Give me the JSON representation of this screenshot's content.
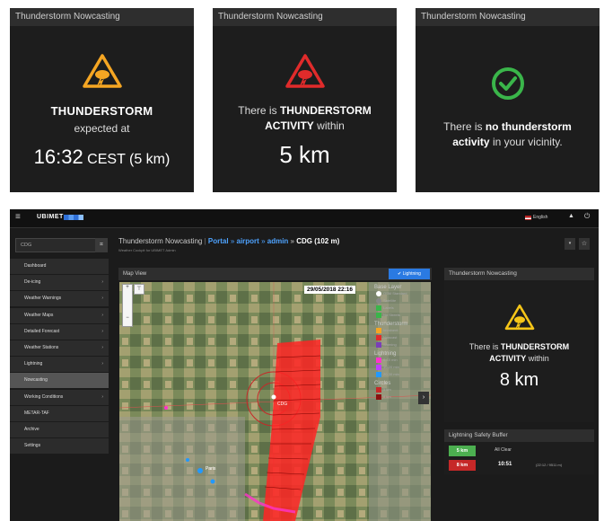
{
  "cards": [
    {
      "header": "Thunderstorm Nowcasting",
      "line1": "THUNDERSTORM",
      "line2": "expected at",
      "time": "16:32",
      "time_suffix": "CEST (5 km)",
      "icon": "orange-warning-icon",
      "color": "#f5a623"
    },
    {
      "header": "Thunderstorm Nowcasting",
      "prefix": "There is",
      "bold1": "THUNDERSTORM",
      "bold2": "ACTIVITY",
      "suffix": "within",
      "distance": "5 km",
      "icon": "red-warning-icon",
      "color": "#e02b2b"
    },
    {
      "header": "Thunderstorm Nowcasting",
      "prefix": "There is",
      "bold1": "no thunderstorm",
      "bold2": "activity",
      "suffix": "in your vicinity.",
      "icon": "green-check-icon",
      "color": "#3ab54a"
    }
  ],
  "app": {
    "brand": "UBIMET",
    "language": "English",
    "search_value": "CDG",
    "title_prefix": "Thunderstorm Nowcasting",
    "crumb1": "Portal",
    "crumb2": "airport",
    "crumb3": "admin",
    "crumb4": "CDG (102 m)",
    "subtitle": "Weather Cockpit for UBIMET Admin",
    "sidebar": [
      {
        "label": "Dashboard",
        "arrow": false,
        "active": false
      },
      {
        "label": "De-icing",
        "arrow": true,
        "active": false
      },
      {
        "label": "Weather Warnings",
        "arrow": true,
        "active": false
      },
      {
        "label": "Weather Maps",
        "arrow": true,
        "active": false
      },
      {
        "label": "Detailed Forecast",
        "arrow": true,
        "active": false
      },
      {
        "label": "Weather Stations",
        "arrow": true,
        "active": false
      },
      {
        "label": "Lightning",
        "arrow": true,
        "active": false
      },
      {
        "label": "Nowcasting",
        "arrow": false,
        "active": true
      },
      {
        "label": "Working Conditions",
        "arrow": true,
        "active": false
      },
      {
        "label": "METAR-TAF",
        "arrow": false,
        "active": false
      },
      {
        "label": "Archive",
        "arrow": false,
        "active": false
      },
      {
        "label": "Settings",
        "arrow": false,
        "active": false
      }
    ],
    "map": {
      "header": "Map View",
      "lightning_toggle": "Lightning",
      "timestamp": "29/05/2018 22:16",
      "legend_base": "Base Layer",
      "legend_thunderstorm": "Thunderstorm",
      "legend_lightning": "Lightning",
      "legend_circles": "Circles",
      "base_items": [
        "OSM Standard",
        "Satellite",
        "Labels",
        "No Streets"
      ],
      "storm_items": [
        "Imminent",
        "Nowcast",
        "Warning"
      ],
      "lightning_items": [
        "0-10 min",
        "10-20 min",
        "20-30 min"
      ],
      "circle_items": [
        "5 km",
        "8 km"
      ],
      "place1": "CDG",
      "place2": "Paris"
    },
    "nowcast": {
      "header": "Thunderstorm Nowcasting",
      "prefix": "There is",
      "bold1": "THUNDERSTORM",
      "bold2": "ACTIVITY",
      "suffix": "within",
      "distance": "8 km"
    },
    "buffer": {
      "header": "Lightning Safety Buffer",
      "rows": [
        {
          "badge": "5 km",
          "status": "All Clear",
          "time": "",
          "date": "",
          "color": "#4caf50"
        },
        {
          "badge": "8 km",
          "status": "",
          "time": "10:51",
          "date": "(22:12 / 9511 m)",
          "color": "#c62828"
        }
      ]
    }
  }
}
